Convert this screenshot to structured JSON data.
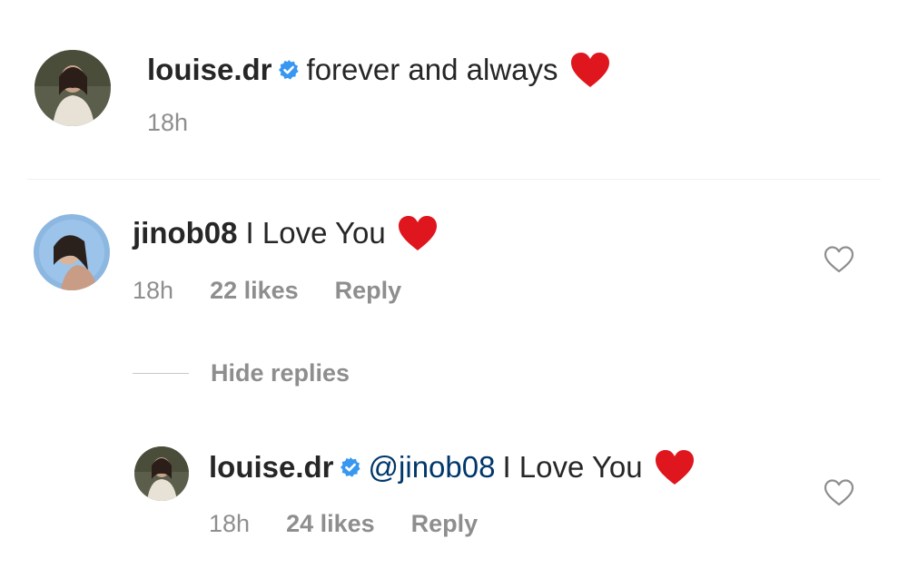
{
  "caption": {
    "username": "louise.dr",
    "text": "forever and always",
    "time": "18h",
    "verified": true,
    "emoji": "red-heart"
  },
  "comment": {
    "username": "jinob08",
    "text": "I Love You",
    "time": "18h",
    "likes": "22 likes",
    "reply_label": "Reply",
    "emoji": "red-heart"
  },
  "hide_replies_label": "Hide replies",
  "reply": {
    "username": "louise.dr",
    "mention": "@jinob08",
    "text": "I Love You",
    "time": "18h",
    "likes": "24 likes",
    "reply_label": "Reply",
    "verified": true,
    "emoji": "red-heart"
  },
  "colors": {
    "verified_blue": "#3897f0",
    "heart_red": "#e0161e",
    "mention_blue": "#00376b",
    "meta_gray": "#8e8e8e"
  }
}
